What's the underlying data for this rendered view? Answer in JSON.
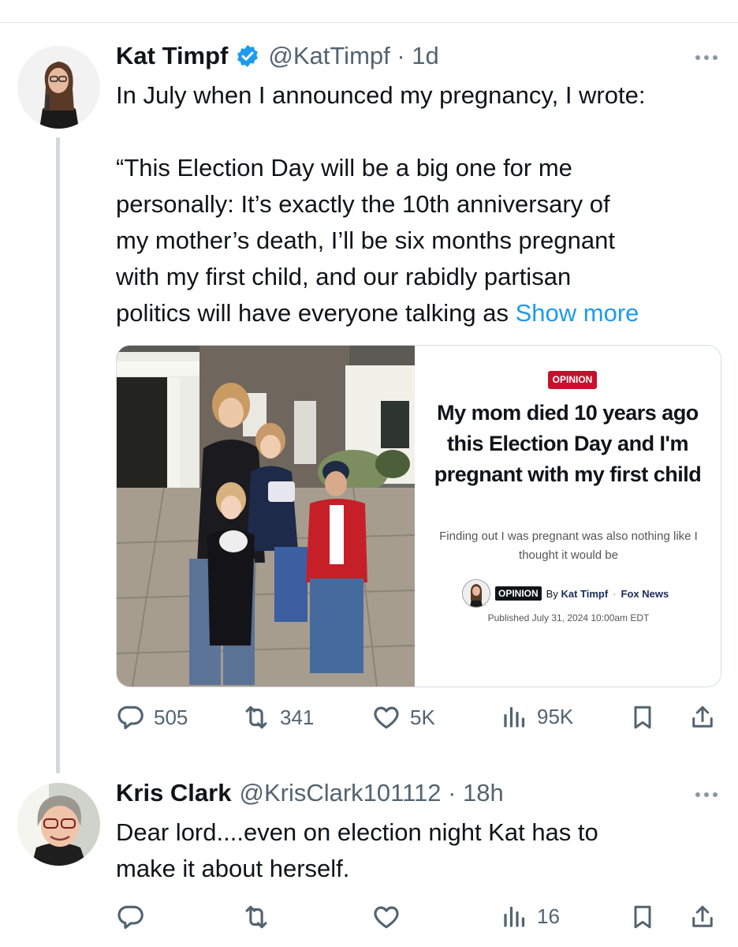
{
  "tweets": [
    {
      "author_name": "Kat Timpf",
      "handle_time": "@KatTimpf · 1d",
      "verified": true,
      "lines": [
        "In July when I announced my pregnancy, I wrote:",
        "",
        "“This Election Day will be a big one for me",
        "personally: It’s exactly the 10th anniversary of",
        "my mother’s death, I’ll be six months pregnant",
        "with my first child, and our rabidly partisan"
      ],
      "last_line": "politics will have everyone talking as ",
      "show_more": "Show more",
      "card": {
        "badge": "OPINION",
        "headline": "My mom died 10 years ago this Election Day and I'm pregnant with my first child",
        "subhead": "Finding out I was pregnant was also nothing like I thought it would be",
        "byline_tag": "OPINION",
        "byline_prefix": "By ",
        "byline_author": "Kat Timpf",
        "byline_sep": "·",
        "byline_source": "Fox News",
        "published": "Published July 31, 2024 10:00am EDT"
      },
      "stats": {
        "replies": "505",
        "reposts": "341",
        "likes": "5K",
        "views": "95K"
      }
    },
    {
      "author_name": "Kris Clark",
      "handle_time": "@KrisClark101112 · 18h",
      "lines": [
        "Dear lord....even on election night Kat has to",
        "make it about herself."
      ],
      "stats": {
        "views": "16"
      }
    }
  ],
  "colors": {
    "accent": "#1d9bf0",
    "text": "#0f1419",
    "muted": "#536471",
    "opinion_red": "#c8102e"
  },
  "icons": [
    "verified-badge-icon",
    "more-icon",
    "reply-icon",
    "repost-icon",
    "like-icon",
    "views-icon",
    "bookmark-icon",
    "share-icon"
  ]
}
